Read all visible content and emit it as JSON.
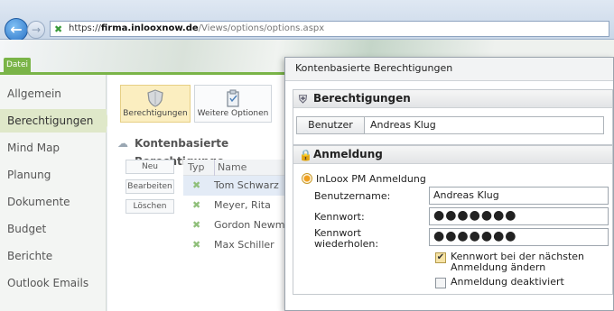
{
  "browser": {
    "url_scheme": "https://",
    "url_host": "firma.inlooxnow.de",
    "url_path": "/Views/options/options.aspx"
  },
  "ribbon": {
    "file_tab": "Datei"
  },
  "sidebar": {
    "items": [
      {
        "label": "Allgemein"
      },
      {
        "label": "Berechtigungen"
      },
      {
        "label": "Mind Map"
      },
      {
        "label": "Planung"
      },
      {
        "label": "Dokumente"
      },
      {
        "label": "Budget"
      },
      {
        "label": "Berichte"
      },
      {
        "label": "Outlook Emails"
      }
    ],
    "active_index": 1
  },
  "toolbar": {
    "berechtigungen_label": "Berechtigungen",
    "weitere_label": "Weitere Optionen"
  },
  "main": {
    "section_title": "Kontenbasierte Berechtigunge",
    "buttons": {
      "neu": "Neu",
      "bearbeiten": "Bearbeiten",
      "loeschen": "Löschen"
    },
    "columns": {
      "typ": "Typ",
      "name": "Name"
    },
    "rows": [
      {
        "name": "Tom Schwarz",
        "selected": true
      },
      {
        "name": "Meyer, Rita",
        "selected": false
      },
      {
        "name": "Gordon Newmar",
        "selected": false
      },
      {
        "name": "Max Schiller",
        "selected": false
      }
    ]
  },
  "dialog": {
    "title": "Kontenbasierte Berechtigungen",
    "berechtigungen_section": "Berechtigungen",
    "benutzer_button": "Benutzer",
    "benutzer_value": "Andreas Klug",
    "anmeldung_section": "Anmeldung",
    "radio_label": "InLoox PM Anmeldung",
    "username_label": "Benutzername:",
    "username_value": "Andreas Klug",
    "password_label": "Kennwort:",
    "password_value": "●●●●●●●",
    "password_repeat_label_1": "Kennwort",
    "password_repeat_label_2": "wiederholen:",
    "password_repeat_value": "●●●●●●●",
    "change_password_label_1": "Kennwort bei der nächsten",
    "change_password_label_2": "Anmeldung ändern",
    "change_password_checked": true,
    "disable_login_label": "Anmeldung deaktiviert",
    "disable_login_checked": false
  },
  "colors": {
    "accent_green": "#7ab448",
    "selection_yellow": "#fbeec0",
    "radio_orange": "#f0a020"
  }
}
